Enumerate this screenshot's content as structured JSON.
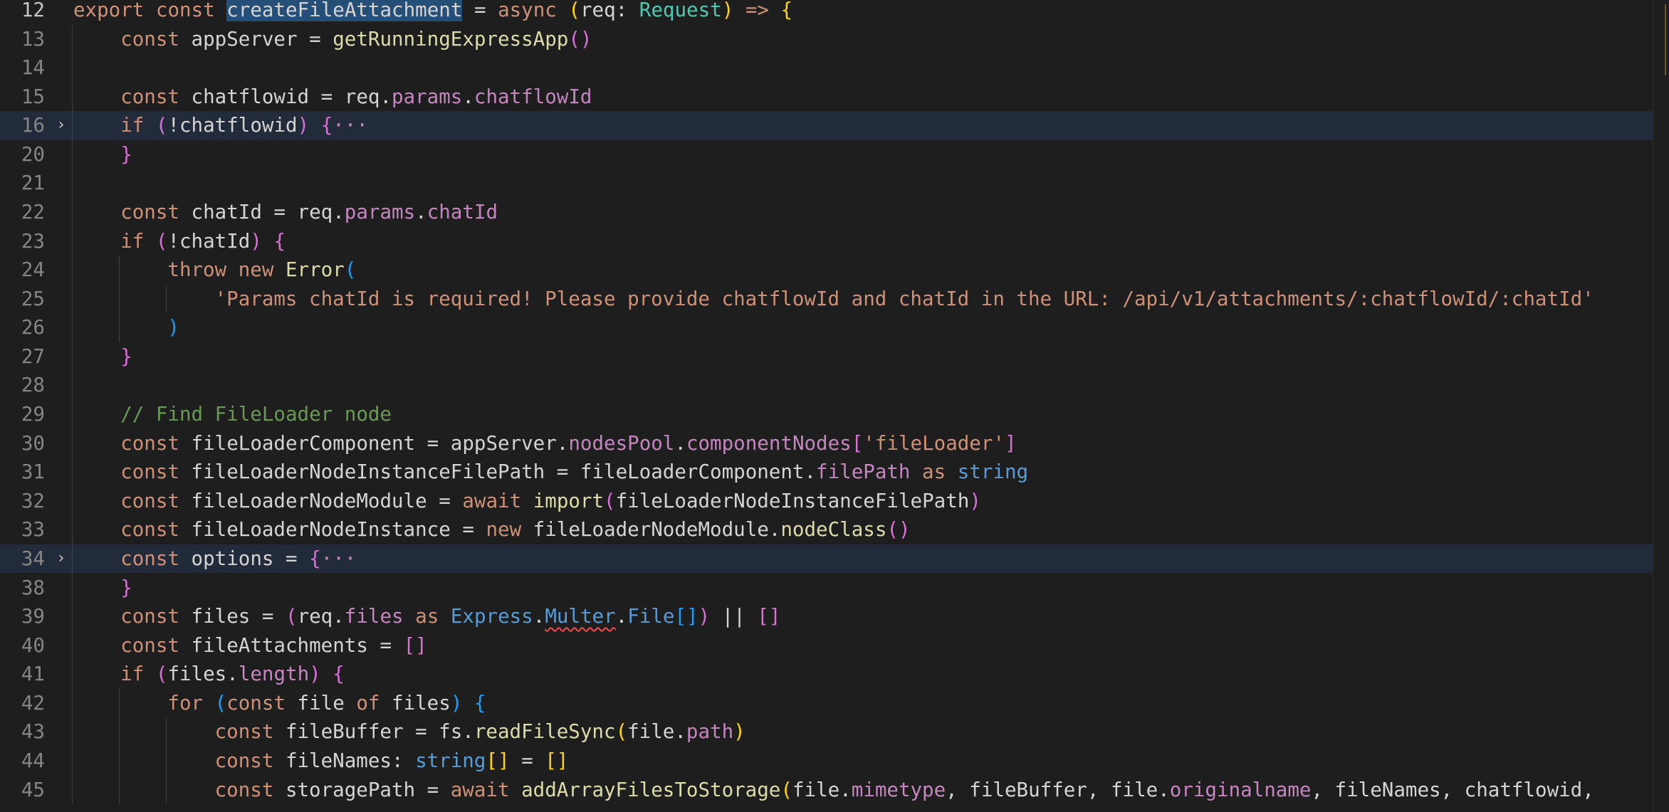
{
  "editor": {
    "language": "typescript",
    "highlighted_symbol": "createFileAttachment",
    "fold_icon": "chevron-right-icon",
    "lines": [
      {
        "n": "12",
        "fold": false,
        "folded": false,
        "indent": 0,
        "tokens": [
          [
            "export",
            "ko"
          ],
          [
            " const",
            "ko"
          ],
          [
            " ",
            ""
          ],
          [
            "createFileAttachment",
            "sel"
          ],
          [
            " = ",
            ""
          ],
          [
            "async",
            "ko"
          ],
          [
            " ",
            ""
          ],
          [
            "(",
            "p1"
          ],
          [
            "req: ",
            ""
          ],
          [
            "Request",
            "type"
          ],
          [
            ") ",
            "p1"
          ],
          [
            "=> ",
            "ko"
          ],
          [
            "{",
            "p1"
          ]
        ]
      },
      {
        "n": "13",
        "fold": false,
        "folded": false,
        "indent": 1,
        "tokens": [
          [
            "const",
            "ko"
          ],
          [
            " appServer = ",
            ""
          ],
          [
            "getRunningExpressApp",
            "fn"
          ],
          [
            "()",
            "p2"
          ]
        ]
      },
      {
        "n": "14",
        "fold": false,
        "folded": false,
        "indent": 1,
        "tokens": []
      },
      {
        "n": "15",
        "fold": false,
        "folded": false,
        "indent": 1,
        "tokens": [
          [
            "const",
            "ko"
          ],
          [
            " chatflowid = req.",
            ""
          ],
          [
            "params",
            "kc"
          ],
          [
            ".",
            ""
          ],
          [
            "chatflowId",
            "kc"
          ]
        ]
      },
      {
        "n": "16",
        "fold": true,
        "folded": true,
        "indent": 1,
        "tokens": [
          [
            "if",
            "ko"
          ],
          [
            " ",
            ""
          ],
          [
            "(",
            "p2"
          ],
          [
            "!chatflowid",
            ""
          ],
          [
            ")",
            "p2"
          ],
          [
            " ",
            ""
          ],
          [
            "{",
            "p2"
          ],
          [
            "···",
            "dots"
          ]
        ]
      },
      {
        "n": "20",
        "fold": false,
        "folded": false,
        "indent": 1,
        "tokens": [
          [
            "}",
            "p2"
          ]
        ]
      },
      {
        "n": "21",
        "fold": false,
        "folded": false,
        "indent": 1,
        "tokens": []
      },
      {
        "n": "22",
        "fold": false,
        "folded": false,
        "indent": 1,
        "tokens": [
          [
            "const",
            "ko"
          ],
          [
            " chatId = req.",
            ""
          ],
          [
            "params",
            "kc"
          ],
          [
            ".",
            ""
          ],
          [
            "chatId",
            "kc"
          ]
        ]
      },
      {
        "n": "23",
        "fold": false,
        "folded": false,
        "indent": 1,
        "tokens": [
          [
            "if",
            "ko"
          ],
          [
            " ",
            ""
          ],
          [
            "(",
            "p2"
          ],
          [
            "!chatId",
            ""
          ],
          [
            ")",
            "p2"
          ],
          [
            " ",
            ""
          ],
          [
            "{",
            "p2"
          ]
        ]
      },
      {
        "n": "24",
        "fold": false,
        "folded": false,
        "indent": 2,
        "tokens": [
          [
            "throw",
            "ko"
          ],
          [
            " ",
            ""
          ],
          [
            "new",
            "ko"
          ],
          [
            " ",
            ""
          ],
          [
            "Error",
            "fn"
          ],
          [
            "(",
            "p3"
          ]
        ]
      },
      {
        "n": "25",
        "fold": false,
        "folded": false,
        "indent": 3,
        "tokens": [
          [
            "'Params chatId is required! Please provide chatflowId and chatId in the URL: /api/v1/attachments/:chatflowId/:chatId'",
            "str"
          ]
        ]
      },
      {
        "n": "26",
        "fold": false,
        "folded": false,
        "indent": 2,
        "tokens": [
          [
            ")",
            "p3"
          ]
        ]
      },
      {
        "n": "27",
        "fold": false,
        "folded": false,
        "indent": 1,
        "tokens": [
          [
            "}",
            "p2"
          ]
        ]
      },
      {
        "n": "28",
        "fold": false,
        "folded": false,
        "indent": 1,
        "tokens": []
      },
      {
        "n": "29",
        "fold": false,
        "folded": false,
        "indent": 1,
        "tokens": [
          [
            "// Find FileLoader node",
            "cmt"
          ]
        ]
      },
      {
        "n": "30",
        "fold": false,
        "folded": false,
        "indent": 1,
        "tokens": [
          [
            "const",
            "ko"
          ],
          [
            " fileLoaderComponent = appServer.",
            ""
          ],
          [
            "nodesPool",
            "kc"
          ],
          [
            ".",
            ""
          ],
          [
            "componentNodes",
            "kc"
          ],
          [
            "[",
            "p2"
          ],
          [
            "'fileLoader'",
            "str"
          ],
          [
            "]",
            "p2"
          ]
        ]
      },
      {
        "n": "31",
        "fold": false,
        "folded": false,
        "indent": 1,
        "tokens": [
          [
            "const",
            "ko"
          ],
          [
            " fileLoaderNodeInstanceFilePath = fileLoaderComponent.",
            ""
          ],
          [
            "filePath",
            "kc"
          ],
          [
            " ",
            ""
          ],
          [
            "as",
            "ko"
          ],
          [
            " ",
            ""
          ],
          [
            "string",
            "kb"
          ]
        ]
      },
      {
        "n": "32",
        "fold": false,
        "folded": false,
        "indent": 1,
        "tokens": [
          [
            "const",
            "ko"
          ],
          [
            " fileLoaderNodeModule = ",
            ""
          ],
          [
            "await",
            "ko"
          ],
          [
            " ",
            ""
          ],
          [
            "import",
            "fn"
          ],
          [
            "(",
            "p2"
          ],
          [
            "fileLoaderNodeInstanceFilePath",
            ""
          ],
          [
            ")",
            "p2"
          ]
        ]
      },
      {
        "n": "33",
        "fold": false,
        "folded": false,
        "indent": 1,
        "tokens": [
          [
            "const",
            "ko"
          ],
          [
            " fileLoaderNodeInstance = ",
            ""
          ],
          [
            "new",
            "ko"
          ],
          [
            " fileLoaderNodeModule.",
            ""
          ],
          [
            "nodeClass",
            "fn"
          ],
          [
            "()",
            "p2"
          ]
        ]
      },
      {
        "n": "34",
        "fold": true,
        "folded": true,
        "indent": 1,
        "tokens": [
          [
            "const",
            "ko"
          ],
          [
            " options = ",
            ""
          ],
          [
            "{",
            "p2"
          ],
          [
            "···",
            "dots"
          ]
        ]
      },
      {
        "n": "38",
        "fold": false,
        "folded": false,
        "indent": 1,
        "tokens": [
          [
            "}",
            "p2"
          ]
        ]
      },
      {
        "n": "39",
        "fold": false,
        "folded": false,
        "indent": 1,
        "tokens": [
          [
            "const",
            "ko"
          ],
          [
            " files = ",
            ""
          ],
          [
            "(",
            "p2"
          ],
          [
            "req.",
            ""
          ],
          [
            "files",
            "kc"
          ],
          [
            " ",
            ""
          ],
          [
            "as",
            "ko"
          ],
          [
            " ",
            ""
          ],
          [
            "Express",
            "kb"
          ],
          [
            ".",
            ""
          ],
          [
            "Multer",
            "kbsq"
          ],
          [
            ".",
            ""
          ],
          [
            "File",
            "kb"
          ],
          [
            "[]",
            "p3"
          ],
          [
            ")",
            "p2"
          ],
          [
            " || ",
            ""
          ],
          [
            "[]",
            "p2"
          ]
        ]
      },
      {
        "n": "40",
        "fold": false,
        "folded": false,
        "indent": 1,
        "tokens": [
          [
            "const",
            "ko"
          ],
          [
            " fileAttachments = ",
            ""
          ],
          [
            "[]",
            "p2"
          ]
        ]
      },
      {
        "n": "41",
        "fold": false,
        "folded": false,
        "indent": 1,
        "tokens": [
          [
            "if",
            "ko"
          ],
          [
            " ",
            ""
          ],
          [
            "(",
            "p2"
          ],
          [
            "files.",
            ""
          ],
          [
            "length",
            "kc"
          ],
          [
            ")",
            "p2"
          ],
          [
            " ",
            ""
          ],
          [
            "{",
            "p2"
          ]
        ]
      },
      {
        "n": "42",
        "fold": false,
        "folded": false,
        "indent": 2,
        "tokens": [
          [
            "for",
            "ko"
          ],
          [
            " ",
            ""
          ],
          [
            "(",
            "p3"
          ],
          [
            "const",
            "ko"
          ],
          [
            " file ",
            ""
          ],
          [
            "of",
            "ko"
          ],
          [
            " files",
            ""
          ],
          [
            ")",
            "p3"
          ],
          [
            " ",
            ""
          ],
          [
            "{",
            "p3"
          ]
        ]
      },
      {
        "n": "43",
        "fold": false,
        "folded": false,
        "indent": 3,
        "tokens": [
          [
            "const",
            "ko"
          ],
          [
            " fileBuffer = fs.",
            ""
          ],
          [
            "readFileSync",
            "fn"
          ],
          [
            "(",
            "p1"
          ],
          [
            "file.",
            ""
          ],
          [
            "path",
            "kc"
          ],
          [
            ")",
            "p1"
          ]
        ]
      },
      {
        "n": "44",
        "fold": false,
        "folded": false,
        "indent": 3,
        "tokens": [
          [
            "const",
            "ko"
          ],
          [
            " fileNames: ",
            ""
          ],
          [
            "string",
            "kb"
          ],
          [
            "[]",
            "p1"
          ],
          [
            " = ",
            ""
          ],
          [
            "[]",
            "p1"
          ]
        ]
      },
      {
        "n": "45",
        "fold": false,
        "folded": false,
        "indent": 3,
        "tokens": [
          [
            "const",
            "ko"
          ],
          [
            " storagePath = ",
            ""
          ],
          [
            "await",
            "ko"
          ],
          [
            " ",
            ""
          ],
          [
            "addArrayFilesToStorage",
            "fn"
          ],
          [
            "(",
            "p1"
          ],
          [
            "file.",
            ""
          ],
          [
            "mimetype",
            "kc"
          ],
          [
            ", fileBuffer, file.",
            ""
          ],
          [
            "originalname",
            "kc"
          ],
          [
            ", fileNames, chatflowid,",
            ""
          ]
        ]
      }
    ]
  }
}
